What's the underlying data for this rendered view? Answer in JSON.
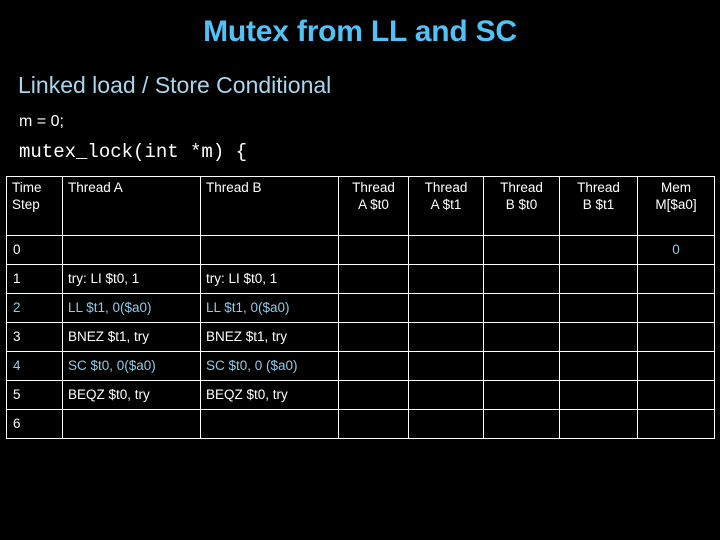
{
  "slide": {
    "title": "Mutex from LL and SC",
    "subtitle": "Linked load / Store Conditional",
    "code_lines": [
      "m = 0;",
      "mutex_lock(int *m) {"
    ]
  },
  "colors": {
    "background": "#000000",
    "title": "#4fc3f7",
    "subtitle": "#a6d7ee",
    "body_text": "#ffffff",
    "highlight_text": "#8ecce8",
    "table_border": "#ffffff"
  },
  "table": {
    "headers": [
      "Time Step",
      "Thread A",
      "Thread B",
      "Thread A $t0",
      "Thread A $t1",
      "Thread B $t0",
      "Thread B $t1",
      "Mem M[$a0]"
    ],
    "header_lines": {
      "step_line1": "Time",
      "step_line2": "Step",
      "thread_a": "Thread A",
      "thread_b": "Thread B",
      "a_t0_line1": "Thread",
      "a_t0_line2": "A $t0",
      "a_t1_line1": "Thread",
      "a_t1_line2": "A $t1",
      "b_t0_line1": "Thread",
      "b_t0_line2": "B $t0",
      "b_t1_line1": "Thread",
      "b_t1_line2": "B $t1",
      "mem_line1": "Mem",
      "mem_line2": "M[$a0]"
    },
    "rows": [
      {
        "step": "0",
        "thread_a": "",
        "thread_b": "",
        "a_t0": "",
        "a_t1": "",
        "b_t0": "",
        "b_t1": "",
        "mem": "0",
        "highlight": false
      },
      {
        "step": "1",
        "thread_a": "try: LI $t0, 1",
        "thread_b": "try: LI $t0, 1",
        "a_t0": "",
        "a_t1": "",
        "b_t0": "",
        "b_t1": "",
        "mem": "",
        "highlight": false
      },
      {
        "step": "2",
        "thread_a": "LL $t1, 0($a0)",
        "thread_b": "LL $t1, 0($a0)",
        "a_t0": "",
        "a_t1": "",
        "b_t0": "",
        "b_t1": "",
        "mem": "",
        "highlight": true
      },
      {
        "step": "3",
        "thread_a": "BNEZ $t1, try",
        "thread_b": "BNEZ $t1, try",
        "a_t0": "",
        "a_t1": "",
        "b_t0": "",
        "b_t1": "",
        "mem": "",
        "highlight": false
      },
      {
        "step": "4",
        "thread_a": "SC $t0, 0($a0)",
        "thread_b": "SC $t0, 0 ($a0)",
        "a_t0": "",
        "a_t1": "",
        "b_t0": "",
        "b_t1": "",
        "mem": "",
        "highlight": true
      },
      {
        "step": "5",
        "thread_a": "BEQZ $t0, try",
        "thread_b": "BEQZ $t0, try",
        "a_t0": "",
        "a_t1": "",
        "b_t0": "",
        "b_t1": "",
        "mem": "",
        "highlight": false
      },
      {
        "step": "6",
        "thread_a": "",
        "thread_b": "",
        "a_t0": "",
        "a_t1": "",
        "b_t0": "",
        "b_t1": "",
        "mem": "",
        "highlight": false
      }
    ]
  }
}
